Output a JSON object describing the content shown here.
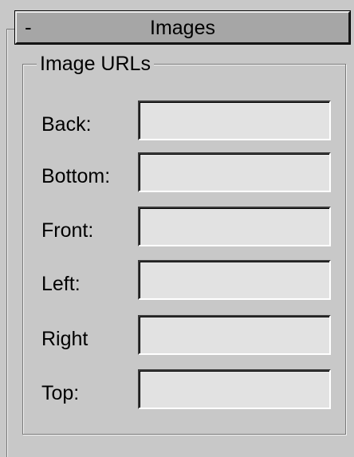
{
  "rollout": {
    "toggle_symbol": "-",
    "title": "Images"
  },
  "group": {
    "legend": "Image URLs"
  },
  "fields": [
    {
      "label": "Back:",
      "value": "",
      "placeholder": ""
    },
    {
      "label": "Bottom:",
      "value": "",
      "placeholder": ""
    },
    {
      "label": "Front:",
      "value": "",
      "placeholder": ""
    },
    {
      "label": "Left:",
      "value": "",
      "placeholder": ""
    },
    {
      "label": "Right",
      "value": "",
      "placeholder": ""
    },
    {
      "label": "Top:",
      "value": "",
      "placeholder": ""
    }
  ]
}
